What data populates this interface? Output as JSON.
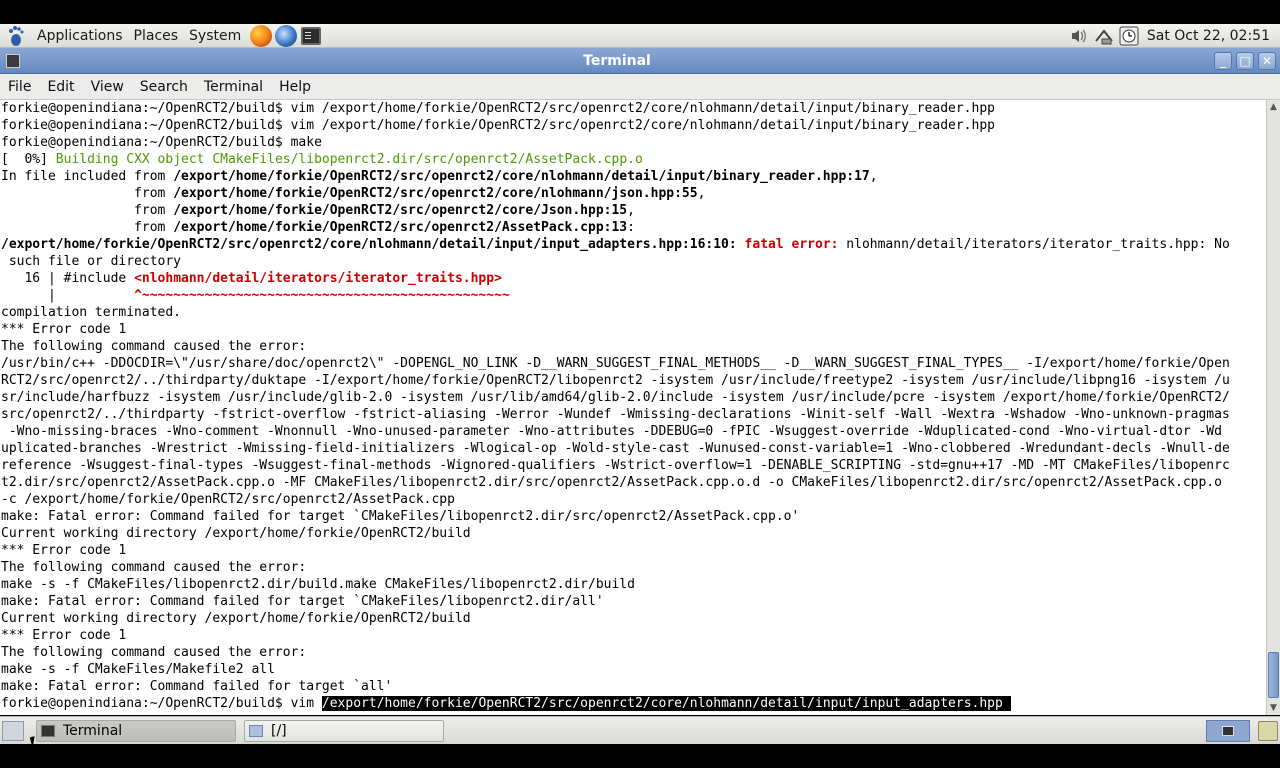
{
  "top_panel": {
    "menus": [
      "Applications",
      "Places",
      "System"
    ],
    "launchers": [
      "firefox-icon",
      "thunderbird-icon",
      "terminal-icon"
    ],
    "tray": [
      "speaker-icon",
      "network-icon",
      "clock-icon"
    ],
    "clock": "Sat Oct 22, 02:51"
  },
  "window": {
    "title": "Terminal",
    "buttons": [
      "minimize",
      "maximize",
      "close"
    ]
  },
  "menubar": [
    "File",
    "Edit",
    "View",
    "Search",
    "Terminal",
    "Help"
  ],
  "terminal": {
    "lines": [
      [
        {
          "t": "forkie@openindiana:~/OpenRCT2/build$ vim /export/home/forkie/OpenRCT2/src/openrct2/core/nlohmann/detail/input/binary_reader.hpp"
        }
      ],
      [
        {
          "t": "forkie@openindiana:~/OpenRCT2/build$ vim /export/home/forkie/OpenRCT2/src/openrct2/core/nlohmann/detail/input/binary_reader.hpp"
        }
      ],
      [
        {
          "t": "forkie@openindiana:~/OpenRCT2/build$ make"
        }
      ],
      [
        {
          "t": "[  0%] "
        },
        {
          "t": "Building CXX object CMakeFiles/libopenrct2.dir/src/openrct2/AssetPack.cpp.o",
          "s": "green"
        }
      ],
      [
        {
          "t": "In file included from "
        },
        {
          "t": "/export/home/forkie/OpenRCT2/src/openrct2/core/nlohmann/detail/input/binary_reader.hpp:17",
          "s": "b"
        },
        {
          "t": ","
        }
      ],
      [
        {
          "t": "                 from "
        },
        {
          "t": "/export/home/forkie/OpenRCT2/src/openrct2/core/nlohmann/json.hpp:55",
          "s": "b"
        },
        {
          "t": ","
        }
      ],
      [
        {
          "t": "                 from "
        },
        {
          "t": "/export/home/forkie/OpenRCT2/src/openrct2/core/Json.hpp:15",
          "s": "b"
        },
        {
          "t": ","
        }
      ],
      [
        {
          "t": "                 from "
        },
        {
          "t": "/export/home/forkie/OpenRCT2/src/openrct2/AssetPack.cpp:13",
          "s": "b"
        },
        {
          "t": ":"
        }
      ],
      [
        {
          "t": "/export/home/forkie/OpenRCT2/src/openrct2/core/nlohmann/detail/input/input_adapters.hpp:16:10: ",
          "s": "b"
        },
        {
          "t": "fatal error: ",
          "s": "red"
        },
        {
          "t": "nlohmann/detail/iterators/iterator_traits.hpp: No"
        }
      ],
      [
        {
          "t": " such file or directory"
        }
      ],
      [
        {
          "t": "   16 | #include "
        },
        {
          "t": "<nlohmann/detail/iterators/iterator_traits.hpp>",
          "s": "red"
        }
      ],
      [
        {
          "t": "      |          "
        },
        {
          "t": "^~~~~~~~~~~~~~~~~~~~~~~~~~~~~~~~~~~~~~~~~~~~~~~~",
          "s": "red"
        }
      ],
      [
        {
          "t": "compilation terminated."
        }
      ],
      [
        {
          "t": "*** Error code 1"
        }
      ],
      [
        {
          "t": "The following command caused the error:"
        }
      ],
      [
        {
          "t": "/usr/bin/c++ -DDOCDIR=\\\"/usr/share/doc/openrct2\\\" -DOPENGL_NO_LINK -D__WARN_SUGGEST_FINAL_METHODS__ -D__WARN_SUGGEST_FINAL_TYPES__ -I/export/home/forkie/Open"
        }
      ],
      [
        {
          "t": "RCT2/src/openrct2/../thirdparty/duktape -I/export/home/forkie/OpenRCT2/libopenrct2 -isystem /usr/include/freetype2 -isystem /usr/include/libpng16 -isystem /u"
        }
      ],
      [
        {
          "t": "sr/include/harfbuzz -isystem /usr/include/glib-2.0 -isystem /usr/lib/amd64/glib-2.0/include -isystem /usr/include/pcre -isystem /export/home/forkie/OpenRCT2/"
        }
      ],
      [
        {
          "t": "src/openrct2/../thirdparty -fstrict-overflow -fstrict-aliasing -Werror -Wundef -Wmissing-declarations -Winit-self -Wall -Wextra -Wshadow -Wno-unknown-pragmas"
        }
      ],
      [
        {
          "t": " -Wno-missing-braces -Wno-comment -Wnonnull -Wno-unused-parameter -Wno-attributes -DDEBUG=0 -fPIC -Wsuggest-override -Wduplicated-cond -Wno-virtual-dtor -Wd"
        }
      ],
      [
        {
          "t": "uplicated-branches -Wrestrict -Wmissing-field-initializers -Wlogical-op -Wold-style-cast -Wunused-const-variable=1 -Wno-clobbered -Wredundant-decls -Wnull-de"
        }
      ],
      [
        {
          "t": "reference -Wsuggest-final-types -Wsuggest-final-methods -Wignored-qualifiers -Wstrict-overflow=1 -DENABLE_SCRIPTING -std=gnu++17 -MD -MT CMakeFiles/libopenrc"
        }
      ],
      [
        {
          "t": "t2.dir/src/openrct2/AssetPack.cpp.o -MF CMakeFiles/libopenrct2.dir/src/openrct2/AssetPack.cpp.o.d -o CMakeFiles/libopenrct2.dir/src/openrct2/AssetPack.cpp.o"
        }
      ],
      [
        {
          "t": "-c /export/home/forkie/OpenRCT2/src/openrct2/AssetPack.cpp"
        }
      ],
      [
        {
          "t": "make: Fatal error: Command failed for target `CMakeFiles/libopenrct2.dir/src/openrct2/AssetPack.cpp.o'"
        }
      ],
      [
        {
          "t": "Current working directory /export/home/forkie/OpenRCT2/build"
        }
      ],
      [
        {
          "t": "*** Error code 1"
        }
      ],
      [
        {
          "t": "The following command caused the error:"
        }
      ],
      [
        {
          "t": "make -s -f CMakeFiles/libopenrct2.dir/build.make CMakeFiles/libopenrct2.dir/build"
        }
      ],
      [
        {
          "t": "make: Fatal error: Command failed for target `CMakeFiles/libopenrct2.dir/all'"
        }
      ],
      [
        {
          "t": "Current working directory /export/home/forkie/OpenRCT2/build"
        }
      ],
      [
        {
          "t": "*** Error code 1"
        }
      ],
      [
        {
          "t": "The following command caused the error:"
        }
      ],
      [
        {
          "t": "make -s -f CMakeFiles/Makefile2 all"
        }
      ],
      [
        {
          "t": "make: Fatal error: Command failed for target `all'"
        }
      ],
      [
        {
          "t": "forkie@openindiana:~/OpenRCT2/build$ vim "
        },
        {
          "t": "/export/home/forkie/OpenRCT2/src/openrct2/core/nlohmann/detail/input/input_adapters.hpp ",
          "s": "hl"
        }
      ]
    ]
  },
  "taskbar": {
    "tasks": [
      "Terminal",
      "[/]"
    ]
  }
}
